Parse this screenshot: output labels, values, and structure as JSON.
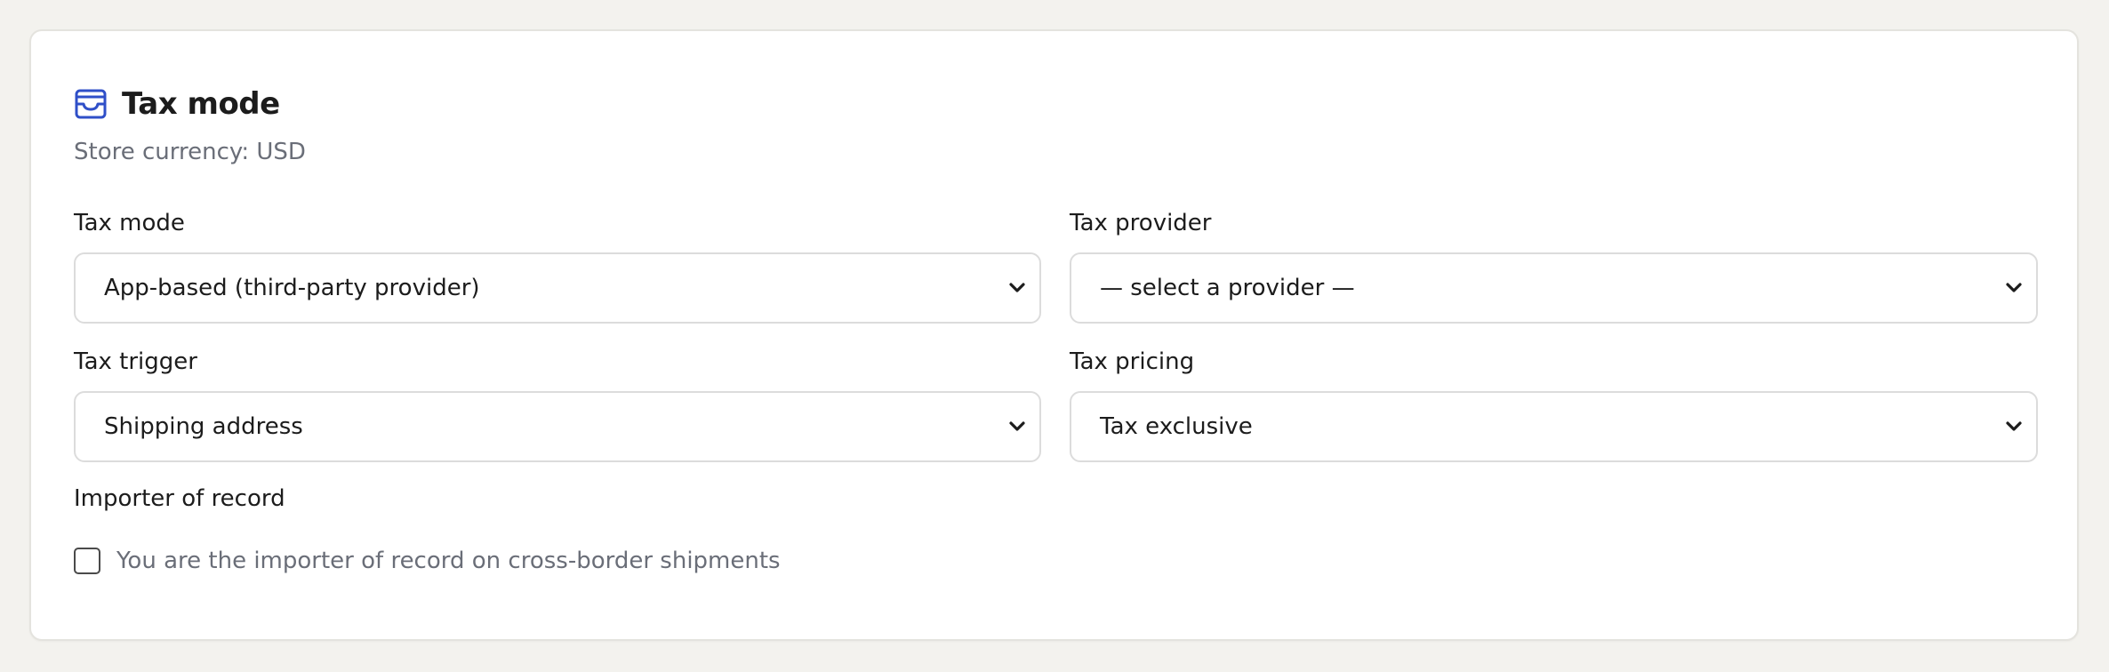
{
  "section": {
    "title": "Tax mode",
    "icon": "tray-icon",
    "accent_color": "#2f4fc8",
    "subtitle": "Store currency: USD"
  },
  "fields": {
    "tax_mode": {
      "label": "Tax mode",
      "value": "App-based (third-party provider)"
    },
    "tax_provider": {
      "label": "Tax provider",
      "value": "— select a provider —"
    },
    "tax_trigger": {
      "label": "Tax trigger",
      "value": "Shipping address"
    },
    "tax_pricing": {
      "label": "Tax pricing",
      "value": "Tax exclusive"
    },
    "importer_of_record": {
      "label": "Importer of record",
      "checkbox_label": "You are the importer of record on cross-border shipments",
      "checked": false
    }
  }
}
